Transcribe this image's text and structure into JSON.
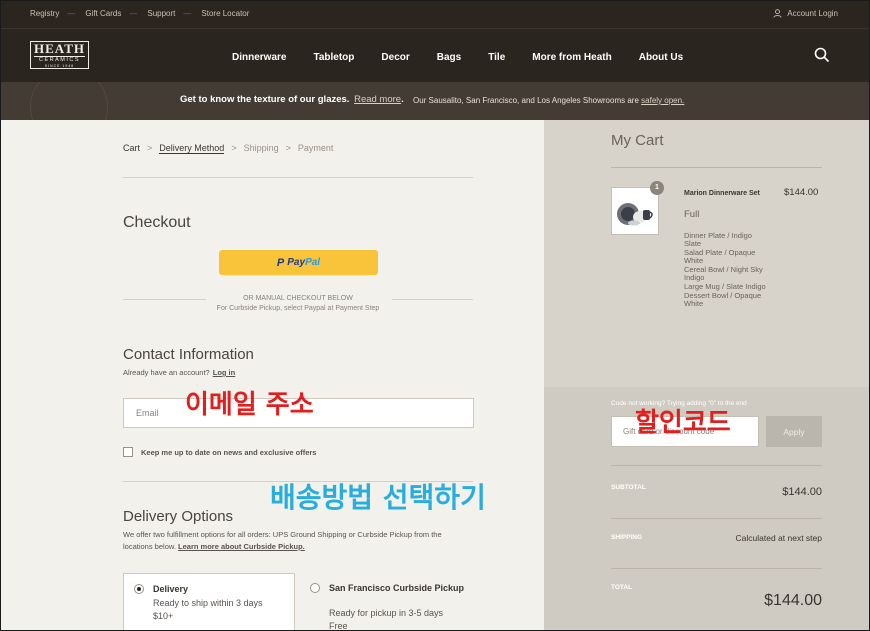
{
  "topbar": {
    "links": [
      "Registry",
      "Gift Cards",
      "Support",
      "Store Locator"
    ],
    "account_label": "Account Login"
  },
  "nav": {
    "logo_top": "HEATH",
    "logo_mid": "CERAMICS",
    "logo_small": "SINCE 1948",
    "items": [
      "Dinnerware",
      "Tabletop",
      "Decor",
      "Bags",
      "Tile",
      "More from Heath",
      "About Us"
    ]
  },
  "promo": {
    "message": "Get to know the texture of our glazes.",
    "read_more": "Read more",
    "showrooms": "Our Sausalito, San Francisco, and Los Angeles Showrooms are",
    "safely_open": "safely open."
  },
  "breadcrumb": [
    "Cart",
    "Delivery Method",
    "Shipping",
    "Payment"
  ],
  "checkout": {
    "title": "Checkout",
    "paypal_pay": "Pay",
    "paypal_pal": "Pal",
    "or_manual": "OR MANUAL CHECKOUT BELOW",
    "curbside_note": "For Curbside Pickup, select Paypal at Payment Step"
  },
  "contact": {
    "title": "Contact Information",
    "already": "Already have an account?",
    "login": "Log in",
    "email_placeholder": "Email",
    "newsletter": "Keep me up to date on news and exclusive offers"
  },
  "delivery": {
    "title": "Delivery Options",
    "offer": "We offer two fulfillment options for all orders: UPS Ground Shipping or Curbside Pickup from the locations below.",
    "learn_more": "Learn more about Curbside Pickup.",
    "options": [
      {
        "title": "Delivery",
        "line1": "Ready to ship within 3 days",
        "line2": "$10+",
        "selected": true
      },
      {
        "title": "San Francisco Curbside Pickup",
        "line1": "Ready for pickup in 3-5 days",
        "line2": "Free",
        "selected": false
      }
    ]
  },
  "cart": {
    "title": "My Cart",
    "item": {
      "quantity": "1",
      "name": "Marion Dinnerware Set",
      "variant": "Full",
      "price": "$144.00",
      "contents": [
        "Dinner Plate / Indigo Slate",
        "Salad Plate / Opaque White",
        "Cereal Bowl / Night Sky Indigo",
        "Large Mug / Slate Indigo",
        "Dessert Bowl / Opaque White"
      ]
    },
    "code_hint": "Code not working? Trying adding \"0\" to the end",
    "gift_placeholder": "Gift card or discount code",
    "apply_label": "Apply",
    "subtotal_label": "SUBTOTAL",
    "subtotal_value": "$144.00",
    "shipping_label": "SHIPPING",
    "shipping_value": "Calculated at next step",
    "total_label": "TOTAL",
    "total_value": "$144.00"
  },
  "annotations": {
    "email": "이메일 주소",
    "discount": "할인코드",
    "delivery": "배송방법 선택하기",
    "colors": {
      "red": "#e02020",
      "blue": "#27aede"
    }
  }
}
